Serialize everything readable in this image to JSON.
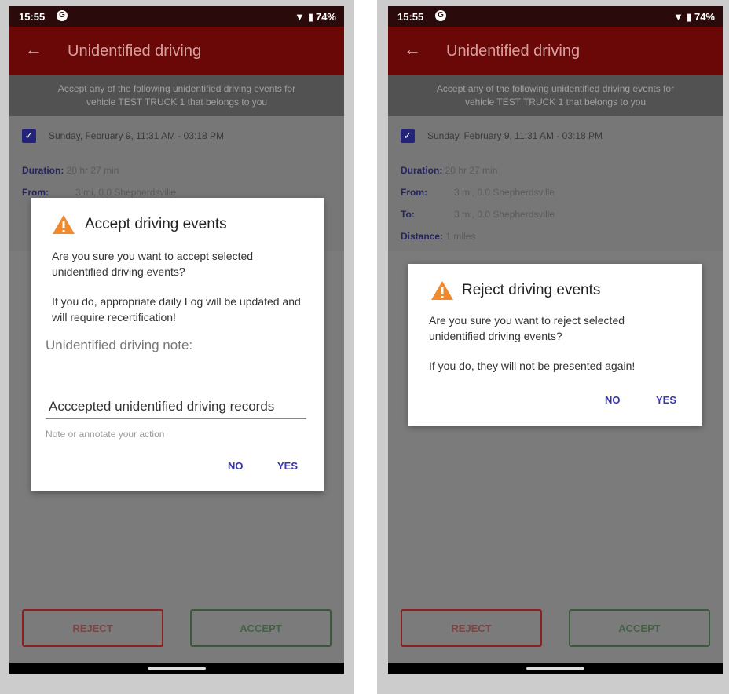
{
  "status_bar": {
    "time": "15:55",
    "app_badge": "G",
    "battery": "74%"
  },
  "app_bar": {
    "title": "Unidentified driving"
  },
  "notice": {
    "line1": "Accept any of the following unidentified driving events for",
    "line2": "vehicle TEST TRUCK 1 that belongs to you"
  },
  "event": {
    "date": "Sunday, February 9, 11:31 AM - 03:18 PM",
    "duration_label": "Duration:",
    "duration_value": "20 hr 27 min",
    "from_label": "From:",
    "from_value": "3 mi, 0.0 Shepherdsville",
    "to_label": "To:",
    "to_value": "3 mi, 0.0 Shepherdsville",
    "distance_label": "Distance:",
    "distance_value": "1 miles"
  },
  "buttons": {
    "reject": "REJECT",
    "accept": "ACCEPT"
  },
  "accept_dialog": {
    "title": "Accept driving events",
    "message1": "Are you sure you want to accept selected unidentified driving events?",
    "message2": "If you do, appropriate daily Log will be updated and will require recertification!",
    "note_label": "Unidentified driving note:",
    "note_value": "Acccepted unidentified driving records",
    "helper": "Note or annotate your action",
    "no": "NO",
    "yes": "YES"
  },
  "reject_dialog": {
    "title": "Reject driving events",
    "message1": "Are you sure you want to reject selected unidentified driving events?",
    "message2": "If you do, they will not be presented again!",
    "no": "NO",
    "yes": "YES"
  },
  "colors": {
    "app_bar": "#6a0707",
    "status_bar": "#2a0a0a",
    "dialog_action": "#3535b5",
    "warning_icon": "#f08a2c"
  }
}
